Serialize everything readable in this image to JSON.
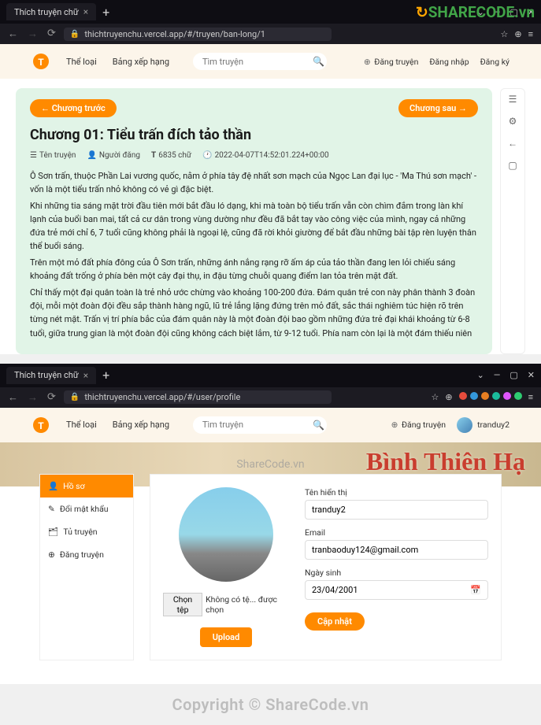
{
  "section1": {
    "tab": "Thích truyện chữ",
    "url": "thichtruyenchu.vercel.app/#/truyen/ban-long/1",
    "nav": {
      "category": "Thể loại",
      "ranking": "Bảng xếp hạng",
      "search_ph": "Tìm truyện",
      "upload": "Đăng truyện",
      "login": "Đăng nhập",
      "signup": "Đăng ký"
    },
    "chapter": {
      "prev": "← Chương trước",
      "next": "Chương sau →",
      "title": "Chương 01: Tiểu trấn đích tảo thần",
      "meta": {
        "story": "Tên truyện",
        "author": "Người đăng",
        "words": "6835 chữ",
        "date": "2022-04-07T14:52:01.224+00:00"
      },
      "p1": "Ô Sơn trấn, thuộc Phần Lai vương quốc, nằm ở phía tây đệ nhất sơn mạch của Ngọc Lan đại lục - 'Ma Thú sơn mạch' - vốn là một tiểu trấn nhỏ không có vẻ gì đặc biệt.",
      "p2": "Khi những tia sáng mặt trời đầu tiên mới bắt đầu ló dạng, khi mà toàn bộ tiểu trấn vẫn còn chìm đắm trong làn khí lạnh của buổi ban mai, tất cả cư dân trong vùng dường như đều đã bắt tay vào công việc của mình, ngay cả những đứa trẻ mới chỉ 6, 7 tuổi cũng không phải là ngoại lệ, cũng đã rời khỏi giường để bắt đầu những bài tập rèn luyện thân thể buổi sáng.",
      "p3": "Trên một mỏ đất phía đông của Ô Sơn trấn, những ánh nắng rạng rỡ ấm áp của tảo thần đang len lỏi chiếu sáng khoảng đất trống ở phía bên một cây đại thụ, in đậu từng chuỗi quang điểm lan tỏa trên mặt đất.",
      "p4": "Chỉ thấy một đại quân toàn là trẻ nhỏ ước chừng vào khoảng 100-200 đứa. Đám quân trẻ con này phân thành 3 đoàn đội, mỗi một đoàn đội đều sắp thành hàng ngũ, lũ trẻ lẳng lặng đứng trên mỏ đất, sắc thái nghiêm túc hiện rõ trên từng nét mặt. Trấn vị trí phía bắc của đám quân này là một đoàn đội bao gồm những đứa trẻ đại khái khoảng từ 6-8 tuổi, giữa trung gian là một đoàn đội cũng không cách biệt lắm, từ 9-12 tuổi. Phía nam còn lại là một đám thiếu niên"
    },
    "watermark": "SHARECODE.vn"
  },
  "section2": {
    "tab": "Thích truyện chữ",
    "url": "thichtruyenchu.vercel.app/#/user/profile",
    "nav": {
      "category": "Thể loại",
      "ranking": "Bảng xếp hạng",
      "search_ph": "Tìm truyện",
      "upload": "Đăng truyện",
      "username": "tranduy2"
    },
    "hero": "Bình Thiên Hạ",
    "hero_wm": "ShareCode.vn",
    "sidebar": [
      "Hồ sơ",
      "Đổi mật khẩu",
      "Tủ truyện",
      "Đăng truyện"
    ],
    "file_btn": "Chọn tệp",
    "file_status": "Không có tệ... được chọn",
    "upload_btn": "Upload",
    "form": {
      "name_lbl": "Tên hiển thị",
      "name_val": "tranduy2",
      "email_lbl": "Email",
      "email_val": "tranbaoduy124@gmail.com",
      "dob_lbl": "Ngày sinh",
      "dob_val": "23/04/2001",
      "submit": "Cập nhật"
    }
  },
  "footer": "Copyright © ShareCode.vn"
}
